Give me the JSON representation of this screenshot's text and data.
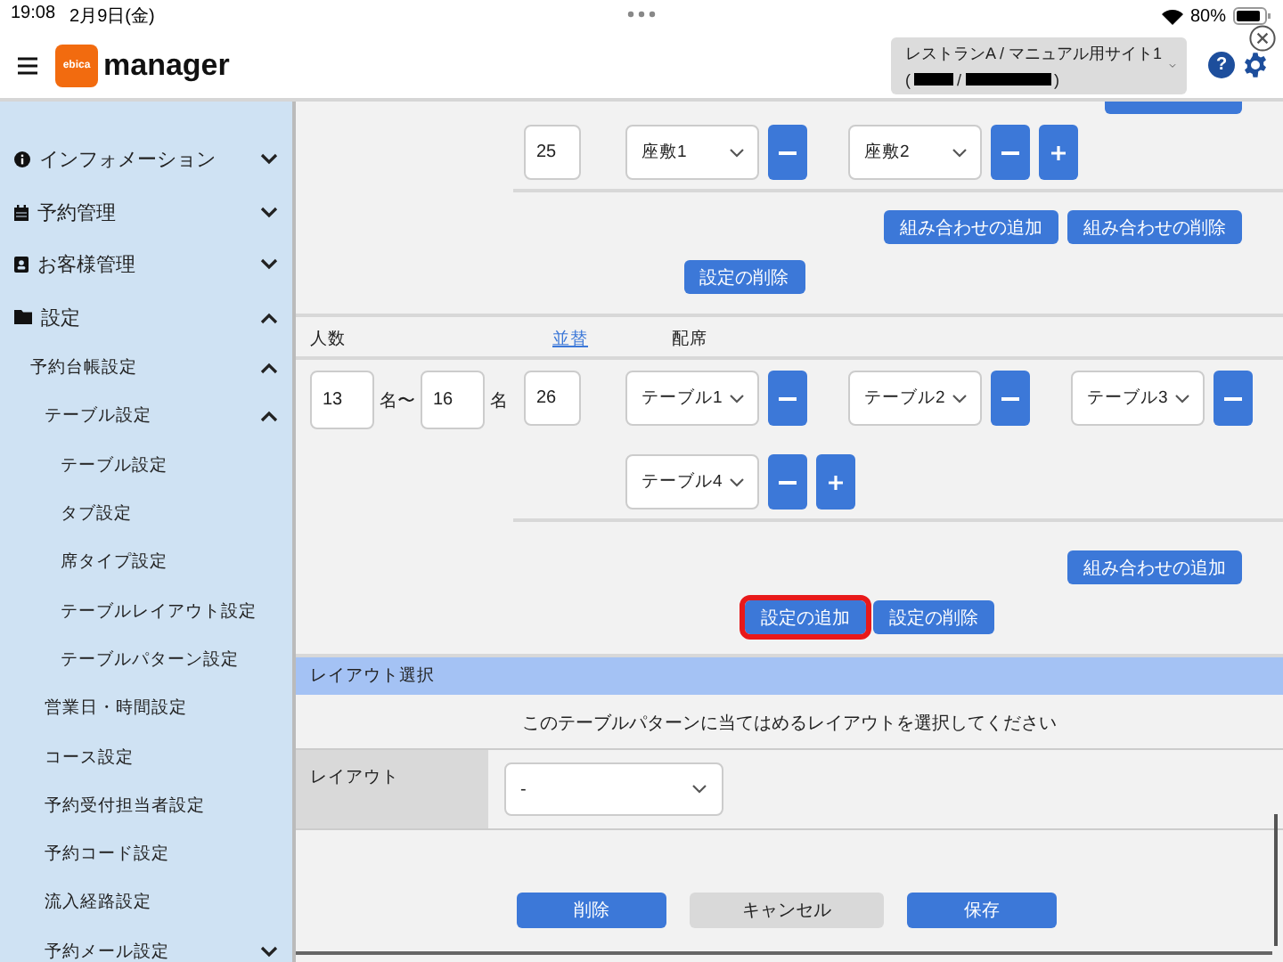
{
  "status_bar": {
    "time": "19:08",
    "date": "2月9日(金)",
    "battery": "80%"
  },
  "header": {
    "logo_badge": "ebica",
    "app_name": "manager",
    "store_selector": {
      "name": "レストランA / マニュアル用サイト1",
      "account_parts": [
        "(",
        "/",
        ")"
      ]
    },
    "help": "?"
  },
  "sidebar": {
    "items": [
      {
        "label": "インフォメーション",
        "expanded": false
      },
      {
        "label": "予約管理",
        "expanded": false
      },
      {
        "label": "お客様管理",
        "expanded": false
      },
      {
        "label": "設定",
        "expanded": true,
        "children": [
          {
            "label": "予約台帳設定",
            "expanded": true,
            "children": [
              {
                "label": "テーブル設定",
                "expanded": true,
                "children": [
                  {
                    "label": "テーブル設定"
                  },
                  {
                    "label": "タブ設定"
                  },
                  {
                    "label": "席タイプ設定"
                  },
                  {
                    "label": "テーブルレイアウト設定"
                  },
                  {
                    "label": "テーブルパターン設定"
                  }
                ]
              },
              {
                "label": "営業日・時間設定"
              },
              {
                "label": "コース設定"
              },
              {
                "label": "予約受付担当者設定"
              },
              {
                "label": "予約コード設定"
              },
              {
                "label": "流入経路設定"
              },
              {
                "label": "予約メール設定",
                "expanded": false
              }
            ]
          }
        ]
      }
    ]
  },
  "sections": [
    {
      "combinations": [
        {
          "order": "25",
          "seats": [
            "座敷1",
            "座敷2"
          ]
        }
      ],
      "combination_buttons": [
        "組み合わせの追加",
        "組み合わせの削除"
      ],
      "buttons": [
        {
          "label": "設定の削除",
          "highlighted": false
        }
      ]
    },
    {
      "columns": [
        {
          "label": "人数",
          "kind": "text"
        },
        {
          "label": "並替",
          "kind": "link"
        },
        {
          "label": "配席",
          "kind": "text"
        }
      ],
      "party": {
        "min": "13",
        "separator": "名〜",
        "max": "16",
        "unit": "名"
      },
      "combinations": [
        {
          "order": "26",
          "seats": [
            "テーブル1",
            "テーブル2",
            "テーブル3",
            "テーブル4"
          ]
        }
      ],
      "combination_buttons": [
        "組み合わせの追加"
      ],
      "buttons": [
        {
          "label": "設定の追加",
          "highlighted": true
        },
        {
          "label": "設定の削除",
          "highlighted": false
        }
      ]
    }
  ],
  "layout_section": {
    "title": "レイアウト選択",
    "instruction": "このテーブルパターンに当てはめるレイアウトを選択してください",
    "field_label": "レイアウト",
    "value": "-"
  },
  "footer_buttons": [
    {
      "label": "削除",
      "kind": "primary"
    },
    {
      "label": "キャンセル",
      "kind": "secondary"
    },
    {
      "label": "保存",
      "kind": "primary"
    }
  ]
}
